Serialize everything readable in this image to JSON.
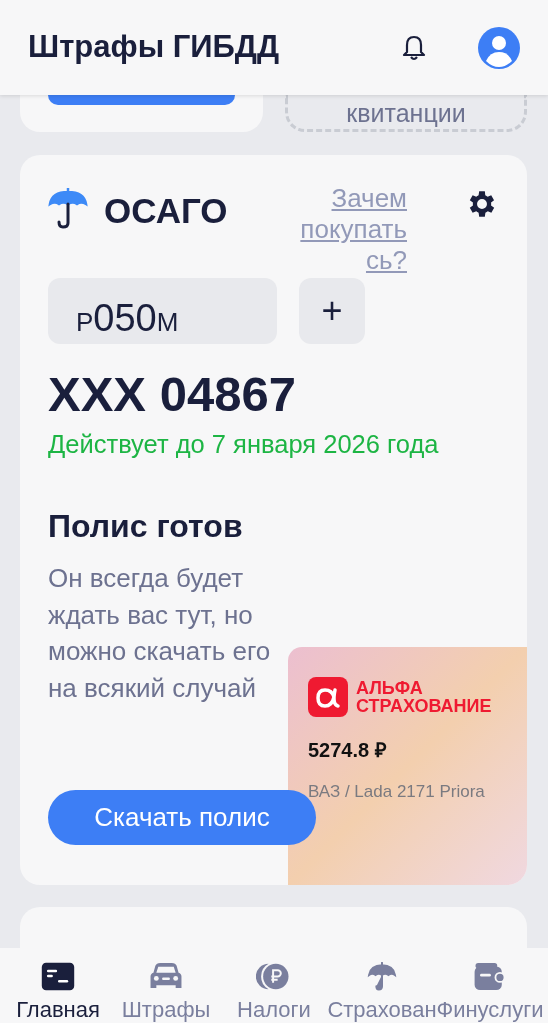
{
  "header": {
    "title": "Штрафы ГИБДД"
  },
  "top_card": {
    "receipt_label": "квитанции"
  },
  "osago": {
    "title": "ОСАГО",
    "why_link": [
      "Зачем",
      "покупать",
      "сь?"
    ],
    "plate": {
      "series": "Р",
      "number": "050",
      "letter": "М"
    },
    "add_button": "+",
    "policy_number": "ХХХ 04867",
    "valid_until": "Действует до 7 января 2026 года",
    "status_title": "Полис готов",
    "description": "Он всегда будет ждать вас тут, но можно скачать его на всякий случай",
    "download_button": "Скачать полис",
    "offer": {
      "insurer": [
        "АЛЬФА",
        "СТРАХОВАНИЕ"
      ],
      "price": "5274.8 ₽",
      "car": "ВАЗ / Lada 2171 Priora"
    }
  },
  "nav": [
    {
      "label": "Главная",
      "selected": true
    },
    {
      "label": "Штрафы",
      "selected": false
    },
    {
      "label": "Налоги",
      "selected": false
    },
    {
      "label": "Страхован",
      "selected": false
    },
    {
      "label": "Финуслуги",
      "selected": false
    }
  ]
}
